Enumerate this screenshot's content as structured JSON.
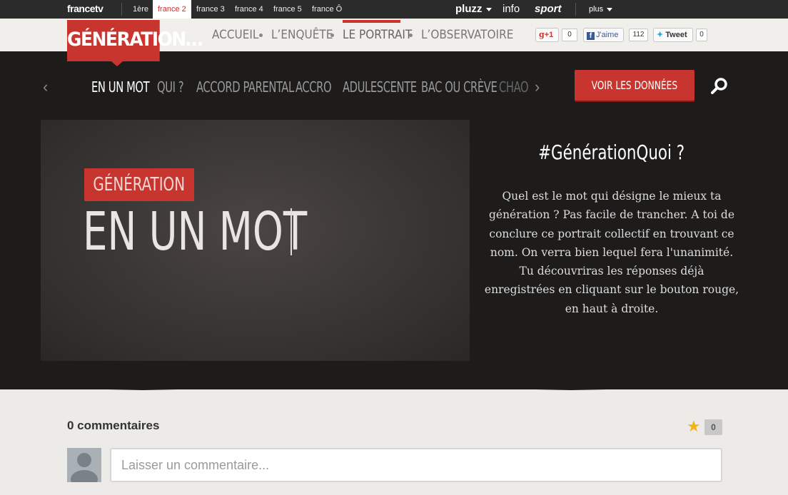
{
  "topbar": {
    "brand": "francetv",
    "channels": [
      {
        "label": "1ère",
        "active": false
      },
      {
        "label": "france 2",
        "active": true
      },
      {
        "label": "france 3",
        "active": false
      },
      {
        "label": "france 4",
        "active": false
      },
      {
        "label": "france 5",
        "active": false
      },
      {
        "label": "france Ô",
        "active": false
      }
    ],
    "pluzz": "pluzz",
    "info": "info",
    "sport": "sport",
    "plus": "plus"
  },
  "header": {
    "logo": "GÉNÉRATION…",
    "nav": [
      {
        "label": "ACCUEIL",
        "active": false
      },
      {
        "label": "L’ENQUÊTE",
        "active": false
      },
      {
        "label": "LE PORTRAIT",
        "active": true
      },
      {
        "label": "L’OBSERVATOIRE",
        "active": false
      }
    ],
    "social": {
      "gplus_label": "+1",
      "gplus_count": "0",
      "fb_label": "J'aime",
      "fb_count": "112",
      "tw_label": "Tweet",
      "tw_count": "0"
    }
  },
  "subnav": {
    "items": [
      {
        "label": "EN UN MOT",
        "active": true
      },
      {
        "label": "QUI ?",
        "active": false
      },
      {
        "label": "ACCORD PARENTAL",
        "active": false
      },
      {
        "label": "ACCRO",
        "active": false
      },
      {
        "label": "ADULESCENTE",
        "active": false
      },
      {
        "label": "BAC OU CRÈVE",
        "active": false
      },
      {
        "label": "CHAO",
        "active": false
      }
    ],
    "cta": "VOIR LES DONNÉES"
  },
  "hero": {
    "tag": "GÉNÉRATION",
    "word": "EN UN MOT",
    "hashtag": "#GénérationQuoi ?",
    "description": "Quel est le mot qui désigne le mieux ta génération ? Pas facile de trancher. A toi de conclure ce portrait collectif en trouvant ce nom. On verra bien lequel fera l'unanimité. Tu découvriras les réponses déjà enregistrées en cliquant sur le bouton rouge, en haut à droite."
  },
  "comments": {
    "title": "0 commentaires",
    "star_count": "0",
    "placeholder": "Laisser un commentaire..."
  },
  "colors": {
    "accent": "#c8352f",
    "hero_bg": "#1d1c1b",
    "page_bg": "#ecebe8"
  }
}
